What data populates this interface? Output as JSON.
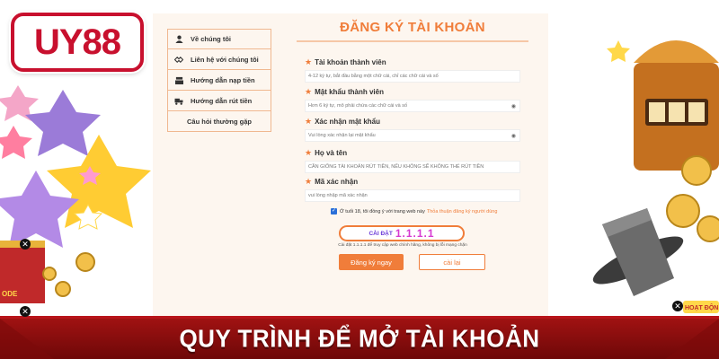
{
  "logo": {
    "text": "UY88"
  },
  "menu": {
    "items": [
      {
        "label": "Về chúng tôi",
        "icon": "user-icon"
      },
      {
        "label": "Liên hệ với chúng tôi",
        "icon": "handshake-icon"
      },
      {
        "label": "Hướng dẫn nạp tiền",
        "icon": "cash-register-icon"
      },
      {
        "label": "Hướng dẫn rút tiền",
        "icon": "truck-icon"
      },
      {
        "label": "Câu hỏi thường gặp",
        "icon": ""
      }
    ]
  },
  "form": {
    "title": "ĐĂNG KÝ TÀI KHOẢN",
    "fields": [
      {
        "label": "Tài khoản thành viên",
        "placeholder": "4-12 ký tự, bắt đầu bằng một chữ cái, chỉ các chữ cái và số",
        "eye": false
      },
      {
        "label": "Mật khẩu thành viên",
        "placeholder": "Hơn 6 ký tự, mô phải chứa các chữ cái và số",
        "eye": true
      },
      {
        "label": "Xác nhận mật khẩu",
        "placeholder": "Vui lòng xác nhận lại mật khẩu",
        "eye": true
      },
      {
        "label": "Họ và tên",
        "placeholder": "CẦN GIỐNG TÀI KHOẢN RÚT TIỀN, NẾU KHÔNG SẼ KHÔNG THỂ RÚT TIỀN",
        "eye": false
      },
      {
        "label": "Mã xác nhận",
        "placeholder": "vui lòng nhập mã xác nhận",
        "eye": false
      }
    ],
    "agree_text": "Ở tuổi 18, tôi đồng ý với trang web này",
    "agree_link": "Thỏa thuận đăng ký người dùng",
    "agree_checked": true,
    "install_label": "CÀI ĐẶT",
    "install_version": "1.1.1.1",
    "install_note": "Cài đặt 1.1.1.1 để truy cập web chính hãng, không bị lỗi mạng chặn",
    "register_label": "Đăng ký ngay",
    "reset_label": "cài lại"
  },
  "banner": {
    "title": "QUY TRÌNH ĐỂ MỞ TÀI KHOẢN"
  },
  "colors": {
    "accent": "#f07d3a",
    "brand_red": "#c8102e",
    "banner_bg": "#8e0d0d",
    "panel_bg": "#fdf6ef"
  }
}
